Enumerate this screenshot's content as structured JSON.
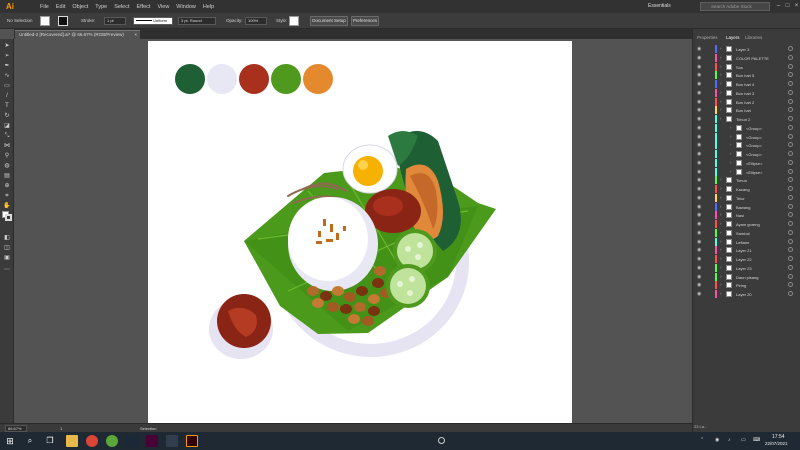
{
  "app": {
    "logo": "Ai",
    "menus": [
      "File",
      "Edit",
      "Object",
      "Type",
      "Select",
      "Effect",
      "View",
      "Window",
      "Help"
    ],
    "workspace": "Essentials",
    "search_placeholder": "Search Adobe Stock"
  },
  "control_bar": {
    "selection": "No Selection",
    "stroke_label": "Stroke:",
    "stroke_value": "1 pt",
    "stroke_profile": "Uniform",
    "brush": "3 pt. Round",
    "opacity_label": "Opacity:",
    "opacity_value": "100%",
    "style_label": "Style:",
    "document_setup": "Document Setup",
    "preferences": "Preferences"
  },
  "document": {
    "tab_title": "Untitled-2 [Recovered].ai* @ 66.67% (RGB/Preview)"
  },
  "status_bar": {
    "zoom": "66.67%",
    "page": "1",
    "tool": "Selection"
  },
  "panels": {
    "tabs": [
      "Properties",
      "Layers",
      "Libraries"
    ],
    "active_tab": "Layers",
    "layers_count": "23 La...",
    "layers": [
      {
        "name": "Layer 3",
        "color": "#4f6cff",
        "indent": false
      },
      {
        "name": "COLOR PALETTE",
        "color": "#ff4fa8",
        "indent": false
      },
      {
        "name": "Sos",
        "color": "#ff4f4f",
        "indent": false
      },
      {
        "name": "Bun hari 5",
        "color": "#4fff4f",
        "indent": false
      },
      {
        "name": "Bun hari 4",
        "color": "#4f6cff",
        "indent": false
      },
      {
        "name": "Bun hari 3",
        "color": "#ff4fa8",
        "indent": false
      },
      {
        "name": "Bun hari 2",
        "color": "#ff4f4f",
        "indent": false
      },
      {
        "name": "Bun hari",
        "color": "#ffd84f",
        "indent": false
      },
      {
        "name": "Timun 2",
        "color": "#4fffe0",
        "indent": false
      },
      {
        "name": "<Group>",
        "color": "#4fffe0",
        "indent": true
      },
      {
        "name": "<Group>",
        "color": "#4fffe0",
        "indent": true
      },
      {
        "name": "<Group>",
        "color": "#4fffe0",
        "indent": true
      },
      {
        "name": "<Group>",
        "color": "#4fffe0",
        "indent": true
      },
      {
        "name": "<Ellipse>",
        "color": "#4fffe0",
        "indent": true
      },
      {
        "name": "<Ellipse>",
        "color": "#4fffe0",
        "indent": true
      },
      {
        "name": "Timun",
        "color": "#4fff4f",
        "indent": false
      },
      {
        "name": "Kacang",
        "color": "#ff4f4f",
        "indent": false
      },
      {
        "name": "Telur",
        "color": "#ffd84f",
        "indent": false
      },
      {
        "name": "Bawang",
        "color": "#4f6cff",
        "indent": false
      },
      {
        "name": "Nasi",
        "color": "#ff4fa8",
        "indent": false
      },
      {
        "name": "Ayam goreng",
        "color": "#ff4f4f",
        "indent": false
      },
      {
        "name": "Sambal",
        "color": "#4fff4f",
        "indent": false
      },
      {
        "name": "Leftane",
        "color": "#4fffe0",
        "indent": false
      },
      {
        "name": "Layer 21",
        "color": "#ff4fa8",
        "indent": false
      },
      {
        "name": "Layer 22",
        "color": "#ff4f4f",
        "indent": false
      },
      {
        "name": "Layer 23",
        "color": "#4fff4f",
        "indent": false
      },
      {
        "name": "Daun pisang",
        "color": "#4fff4f",
        "indent": false
      },
      {
        "name": "Piring",
        "color": "#ff4f4f",
        "indent": false
      },
      {
        "name": "Layer 20",
        "color": "#ff4fa8",
        "indent": false
      }
    ]
  },
  "palette": [
    "#1e5f34",
    "#e8e7f4",
    "#a9301d",
    "#4f9a1e",
    "#e5892f"
  ],
  "taskbar": {
    "time": "17:54",
    "date": "22/07/2021"
  }
}
